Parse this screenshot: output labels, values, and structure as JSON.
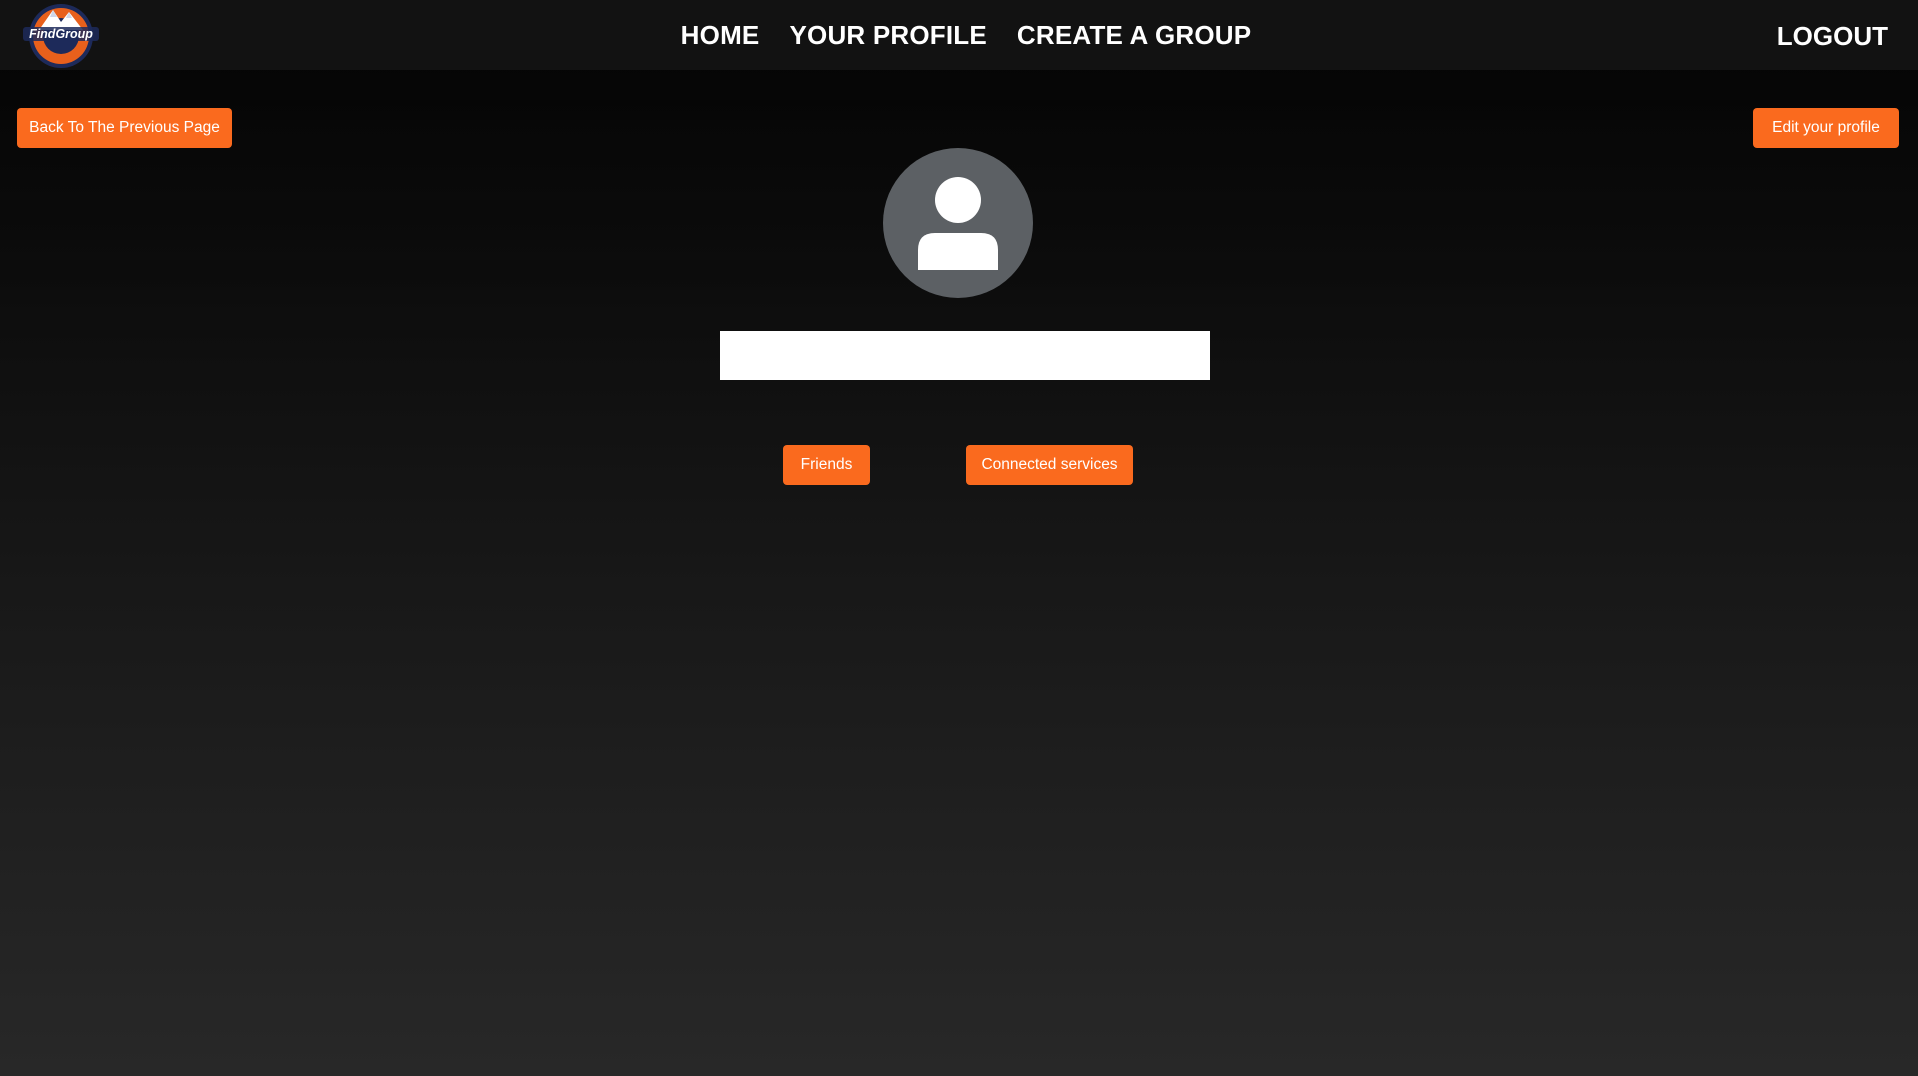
{
  "brand": {
    "name": "FindGroup",
    "logo_text": "FindGroup",
    "colors": {
      "accent": "#fa6a1e",
      "navbar": "#121212",
      "avatar_bg": "#5c6064"
    }
  },
  "nav": {
    "links": [
      "HOME",
      "YOUR PROFILE",
      "CREATE A GROUP"
    ],
    "logout": "LOGOUT"
  },
  "actions": {
    "back": "Back To The Previous Page",
    "edit_profile": "Edit your profile"
  },
  "profile": {
    "avatar_icon": "user-icon",
    "name_value": ""
  },
  "tabs": {
    "friends": "Friends",
    "connected_services": "Connected services"
  }
}
